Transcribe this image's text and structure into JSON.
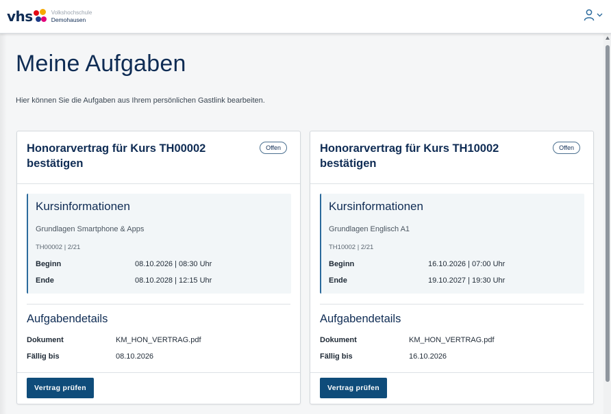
{
  "header": {
    "logo": {
      "word": "vhs",
      "line1": "Volkshochschule",
      "line2": "Demohausen"
    }
  },
  "page": {
    "title": "Meine Aufgaben",
    "intro": "Hier können Sie die Aufgaben aus Ihrem persönlichen Gastlink bearbeiten."
  },
  "cards": [
    {
      "title": "Honorarvertrag für Kurs TH00002 bestätigen",
      "status": "Offen",
      "course": {
        "heading": "Kursinformationen",
        "name": "Grundlagen Smartphone & Apps",
        "code": "TH00002 | 2/21",
        "begin_label": "Beginn",
        "begin_value": "08.10.2026 | 08:30 Uhr",
        "end_label": "Ende",
        "end_value": "08.10.2028 | 12:15 Uhr"
      },
      "details": {
        "heading": "Aufgabendetails",
        "doc_label": "Dokument",
        "doc_value": "KM_HON_VERTRAG.pdf",
        "due_label": "Fällig bis",
        "due_value": "08.10.2026"
      },
      "button": "Vertrag prüfen"
    },
    {
      "title": "Honorarvertrag für Kurs TH10002 bestätigen",
      "status": "Offen",
      "course": {
        "heading": "Kursinformationen",
        "name": "Grundlagen Englisch A1",
        "code": "TH10002 | 2/21",
        "begin_label": "Beginn",
        "begin_value": "16.10.2026 | 07:00 Uhr",
        "end_label": "Ende",
        "end_value": "19.10.2027 | 19:30 Uhr"
      },
      "details": {
        "heading": "Aufgabendetails",
        "doc_label": "Dokument",
        "doc_value": "KM_HON_VERTRAG.pdf",
        "due_label": "Fällig bis",
        "due_value": "16.10.2026"
      },
      "button": "Vertrag prüfen"
    }
  ],
  "colors": {
    "brand_navy": "#0f2c54",
    "button": "#0f4c7a",
    "accent_border": "#2b6a9c",
    "info_bg": "#f2f6f8",
    "page_bg": "#f5f6f7"
  },
  "icons": {
    "user": "user-icon",
    "menu": "chevron-down-icon"
  }
}
